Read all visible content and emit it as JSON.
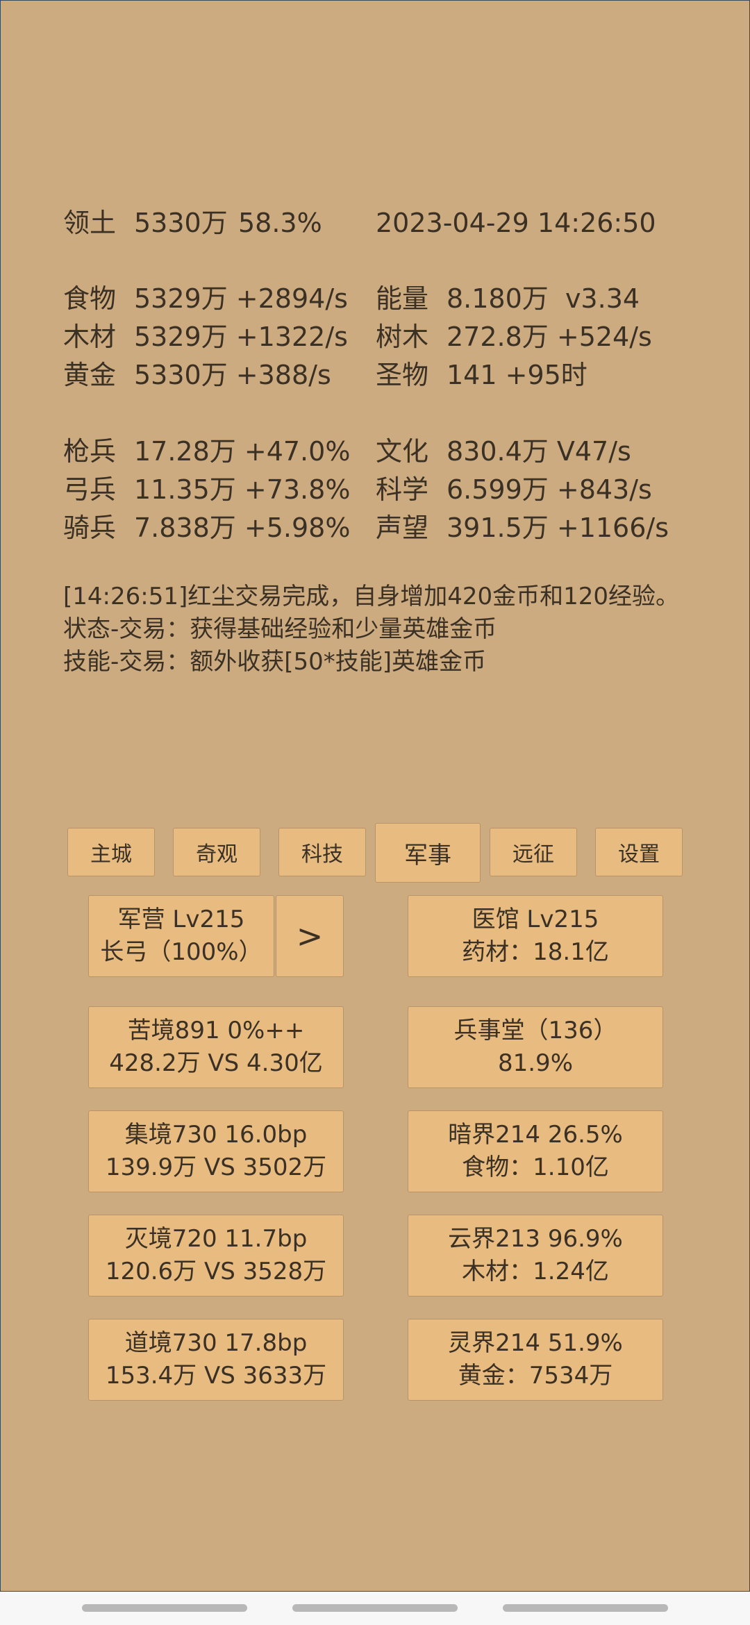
{
  "territory": {
    "label": "领土",
    "value": "5330万",
    "pct": "58.3%"
  },
  "datetime": "2023-04-29 14:26:50",
  "resources_left": [
    {
      "label": "食物",
      "value": "5329万 +2894/s"
    },
    {
      "label": "木材",
      "value": "5329万 +1322/s"
    },
    {
      "label": "黄金",
      "value": "5330万 +388/s"
    }
  ],
  "resources_right": [
    {
      "label": "能量",
      "value": "8.180万  v3.34"
    },
    {
      "label": "树木",
      "value": "272.8万 +524/s"
    },
    {
      "label": "圣物",
      "value": "141 +95时"
    }
  ],
  "troops": [
    {
      "label": "枪兵",
      "value": "17.28万 +47.0%"
    },
    {
      "label": "弓兵",
      "value": "11.35万 +73.8%"
    },
    {
      "label": "骑兵",
      "value": "7.838万 +5.98%"
    }
  ],
  "stats_right": [
    {
      "label": "文化",
      "value": "830.4万 V47/s"
    },
    {
      "label": "科学",
      "value": "6.599万 +843/s"
    },
    {
      "label": "声望",
      "value": "391.5万 +1166/s"
    }
  ],
  "log": [
    "[14:26:51]红尘交易完成，自身增加420金币和120经验。",
    "状态-交易：获得基础经验和少量英雄金币",
    "技能-交易：额外收获[50*技能]英雄金币"
  ],
  "tabs": [
    "主城",
    "奇观",
    "科技",
    "军事",
    "远征",
    "设置"
  ],
  "active_tab": "军事",
  "barracks": {
    "line1": "军营 Lv215",
    "line2": "长弓（100%）",
    "arrow": ">"
  },
  "hospital": {
    "line1": "医馆 Lv215",
    "line2": "药材：18.1亿"
  },
  "left_cards": [
    {
      "line1": "苦境891  0%++",
      "line2": "428.2万 VS 4.30亿"
    },
    {
      "line1": "集境730  16.0bp",
      "line2": "139.9万 VS 3502万"
    },
    {
      "line1": "灭境720  11.7bp",
      "line2": "120.6万 VS 3528万"
    },
    {
      "line1": "道境730  17.8bp",
      "line2": "153.4万 VS 3633万"
    }
  ],
  "right_cards": [
    {
      "line1": "兵事堂（136）",
      "line2": "81.9%"
    },
    {
      "line1": "暗界214  26.5%",
      "line2": "食物：1.10亿"
    },
    {
      "line1": "云界213  96.9%",
      "line2": "木材：1.24亿"
    },
    {
      "line1": "灵界214  51.9%",
      "line2": "黄金：7534万"
    }
  ],
  "colors": {
    "background": "#cdab80",
    "button": "#e8bb81",
    "text": "#3b3024"
  }
}
